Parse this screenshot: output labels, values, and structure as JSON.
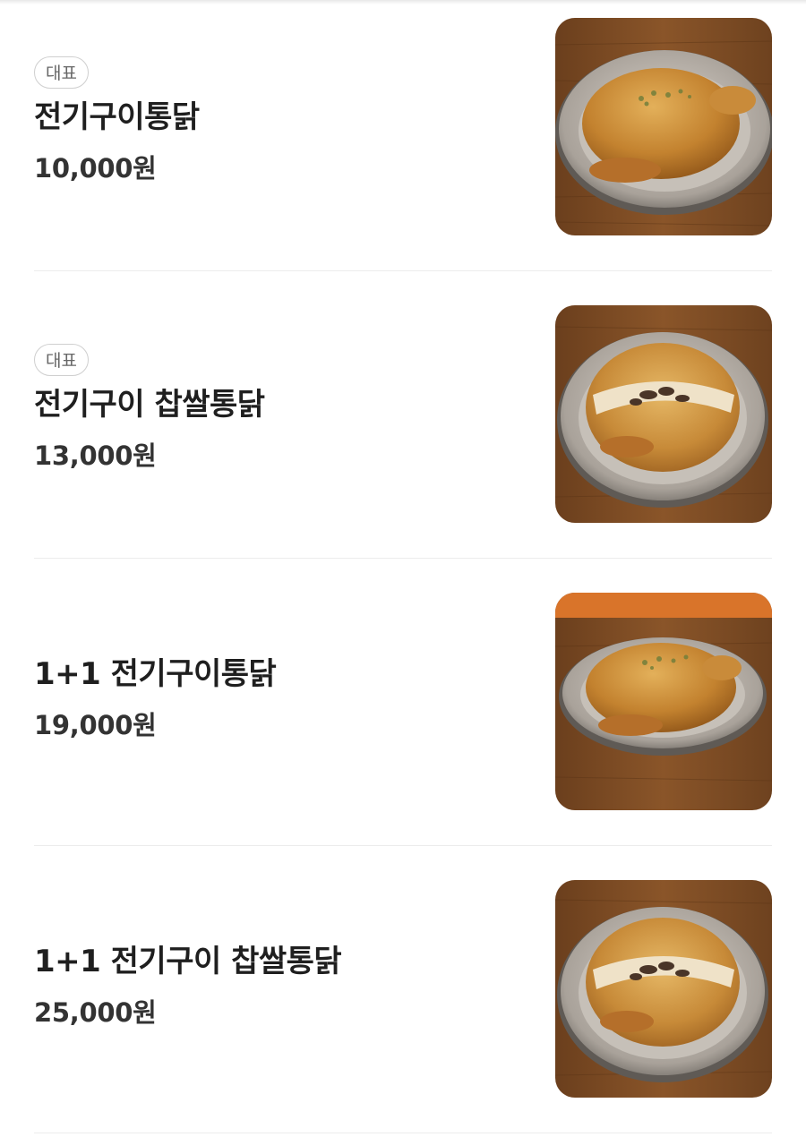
{
  "menu": {
    "items": [
      {
        "badge": "대표",
        "name": "전기구이통닭",
        "price": "10,000원",
        "image": "whole-rotisserie-chicken-photo"
      },
      {
        "badge": "대표",
        "name": "전기구이 찹쌀통닭",
        "price": "13,000원",
        "image": "rice-stuffed-rotisserie-chicken-photo"
      },
      {
        "name": "1+1 전기구이통닭",
        "price": "19,000원",
        "image": "whole-rotisserie-chicken-photo"
      },
      {
        "name": "1+1 전기구이 찹쌀통닭",
        "price": "25,000원",
        "image": "rice-stuffed-rotisserie-chicken-photo"
      }
    ]
  },
  "colors": {
    "table_wood": "#7a4a22",
    "plate_rim": "#b9b2aa",
    "chicken_skin": "#c98b3a",
    "badge_border": "#cfcfcf",
    "divider": "#ececec"
  }
}
